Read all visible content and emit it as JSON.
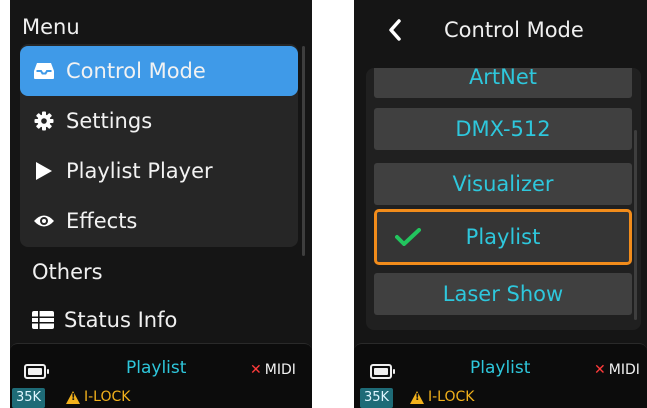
{
  "menu": {
    "title": "Menu",
    "items": [
      {
        "label": "Control Mode",
        "icon": "inbox-icon",
        "selected": true
      },
      {
        "label": "Settings",
        "icon": "gear-icon",
        "selected": false
      },
      {
        "label": "Playlist Player",
        "icon": "play-icon",
        "selected": false
      },
      {
        "label": "Effects",
        "icon": "eye-icon",
        "selected": false
      }
    ],
    "section_label": "Others",
    "status_info_label": "Status Info"
  },
  "control_mode": {
    "title": "Control Mode",
    "options": [
      {
        "label": "ArtNet",
        "selected": false
      },
      {
        "label": "DMX-512",
        "selected": false
      },
      {
        "label": "Visualizer",
        "selected": false
      },
      {
        "label": "Playlist",
        "selected": true
      },
      {
        "label": "Laser Show",
        "selected": false
      }
    ]
  },
  "status_bar": {
    "mode": "Playlist",
    "midi": "MIDI",
    "badge": "35K",
    "lock": "I-LOCK"
  },
  "colors": {
    "accent_blue": "#3f9ae8",
    "cyan_text": "#2ec7dc",
    "selection_orange": "#f28c1b",
    "check_green": "#22c55e",
    "warning_yellow": "#f2b11b",
    "error_red": "#ff3b3b"
  }
}
